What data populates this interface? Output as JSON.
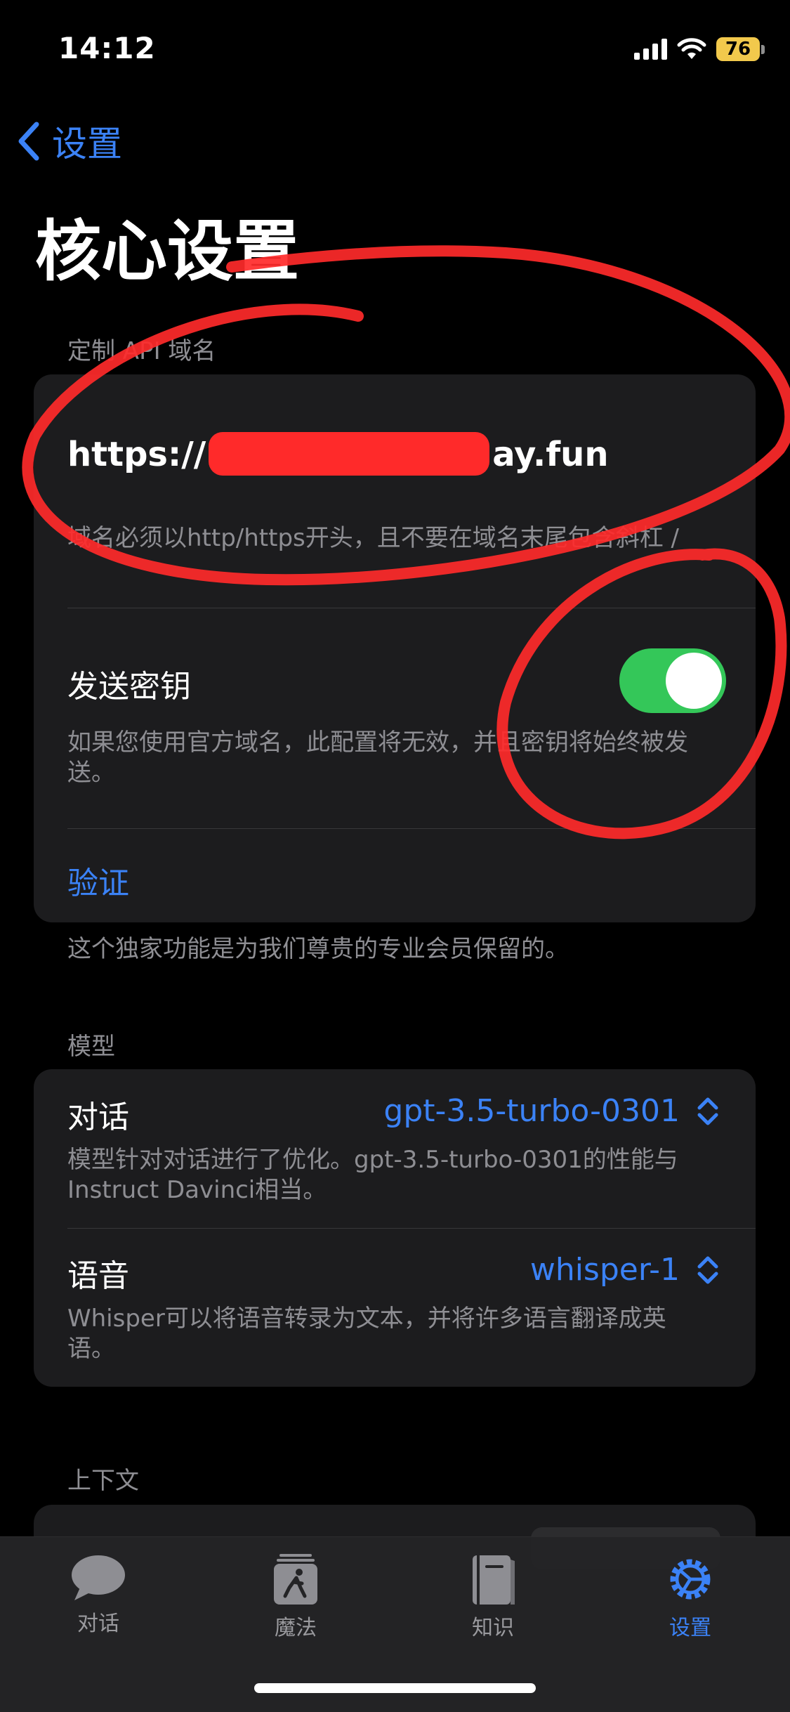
{
  "status": {
    "time": "14:12",
    "battery": "76"
  },
  "nav": {
    "back_label": "设置"
  },
  "page": {
    "title": "核心设置"
  },
  "api_section": {
    "header": "定制 API 域名",
    "domain_prefix": "https://",
    "domain_suffix": "ay.fun",
    "domain_hint": "域名必须以http/https开头，且不要在域名末尾包含斜杠 /",
    "send_key_label": "发送密钥",
    "send_key_on": true,
    "send_key_hint": "如果您使用官方域名，此配置将无效，并且密钥将始终被发送。",
    "verify_label": "验证",
    "footer": "这个独家功能是为我们尊贵的专业会员保留的。"
  },
  "model_section": {
    "header": "模型",
    "chat_label": "对话",
    "chat_value": "gpt-3.5-turbo-0301",
    "chat_hint": "模型针对对话进行了优化。gpt-3.5-turbo-0301的性能与Instruct Davinci相当。",
    "voice_label": "语音",
    "voice_value": "whisper-1",
    "voice_hint": "Whisper可以将语音转录为文本，并将许多语言翻译成英语。"
  },
  "context_section": {
    "header": "上下文"
  },
  "tabs": [
    {
      "label": "对话",
      "icon": "chat-bubble-icon",
      "active": false
    },
    {
      "label": "魔法",
      "icon": "magic-runner-icon",
      "active": false
    },
    {
      "label": "知识",
      "icon": "book-icon",
      "active": false
    },
    {
      "label": "设置",
      "icon": "gear-icon",
      "active": true
    }
  ],
  "colors": {
    "accent": "#3b82f6",
    "toggle_on": "#34c759",
    "annotation": "#ff2a2a",
    "battery": "#f2c94c"
  }
}
